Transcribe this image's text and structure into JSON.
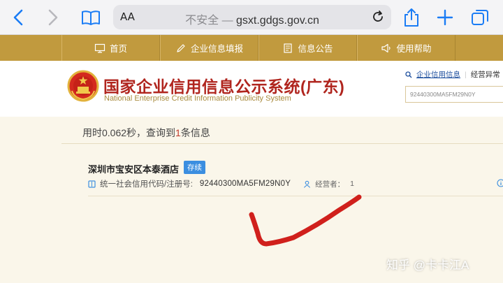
{
  "browser": {
    "text_size_label": "AA",
    "url_insecure_label": "不安全",
    "url_separator": "—",
    "url_domain": "gsxt.gdgs.gov.cn",
    "icons": [
      "back-icon",
      "forward-icon",
      "bookmarks-icon",
      "reload-icon",
      "share-icon",
      "new-tab-icon",
      "tabs-icon"
    ]
  },
  "nav": {
    "items": [
      {
        "label": "首页",
        "icon": "monitor-icon"
      },
      {
        "label": "企业信息填报",
        "icon": "edit-icon"
      },
      {
        "label": "信息公告",
        "icon": "notice-icon"
      },
      {
        "label": "使用帮助",
        "icon": "help-icon"
      }
    ]
  },
  "header": {
    "title_cn": "国家企业信用信息公示系统(广东)",
    "title_en": "National Enterprise Credit Information Publicity System",
    "link_active": "企业信用信息",
    "link_other": "经营异常",
    "search_value": "92440300MA5FM29N0Y"
  },
  "results": {
    "summary_prefix": "用时0.062秒，查询到",
    "count": "1",
    "summary_suffix": "条信息",
    "items": [
      {
        "company": "深圳市宝安区本泰酒店",
        "status": "存续",
        "code_label": "统一社会信用代码/注册号:",
        "code_value": "92440300MA5FM29N0Y",
        "operator_label": "经营者：",
        "operator_value": "1"
      }
    ]
  },
  "watermark": "知乎 @卡卡江A",
  "colors": {
    "nav_gold": "#c19a3e",
    "title_red": "#b0251e",
    "ios_blue": "#1a7cf5",
    "badge_blue": "#3b8ee0",
    "annotation_red": "#d0201c"
  }
}
